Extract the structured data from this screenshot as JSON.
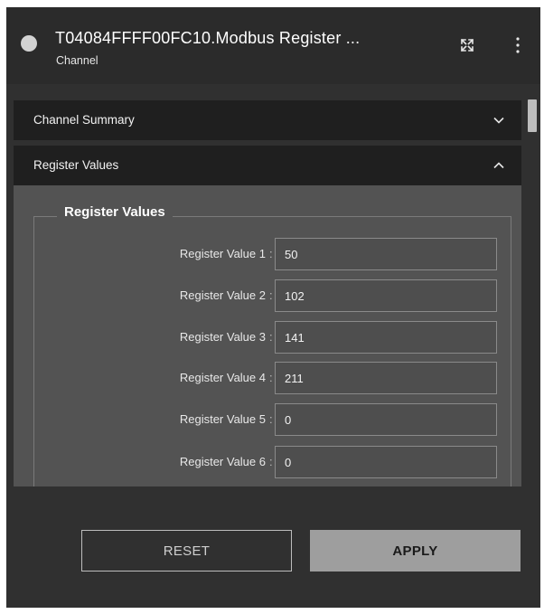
{
  "header": {
    "title": "T04084FFFF00FC10.Modbus Register ...",
    "subtitle": "Channel",
    "expand_icon": "expand-icon",
    "more_icon": "more-vertical-icon",
    "status_color": "#d3d3d3"
  },
  "sections": [
    {
      "label": "Channel Summary",
      "expanded": false
    },
    {
      "label": "Register Values",
      "expanded": true
    }
  ],
  "group": {
    "legend": "Register Values",
    "separator": ":",
    "fields": [
      {
        "label": "Register Value 1",
        "value": "50"
      },
      {
        "label": "Register Value 2",
        "value": "102"
      },
      {
        "label": "Register Value 3",
        "value": "141"
      },
      {
        "label": "Register Value 4",
        "value": "211"
      },
      {
        "label": "Register Value 5",
        "value": "0"
      },
      {
        "label": "Register Value 6",
        "value": "0"
      }
    ]
  },
  "footer": {
    "reset_label": "RESET",
    "apply_label": "APPLY"
  },
  "colors": {
    "panel_bg": "#303030",
    "accordion_bg": "#1f1f1f",
    "content_bg": "#535353",
    "apply_bg": "#9e9e9e"
  }
}
